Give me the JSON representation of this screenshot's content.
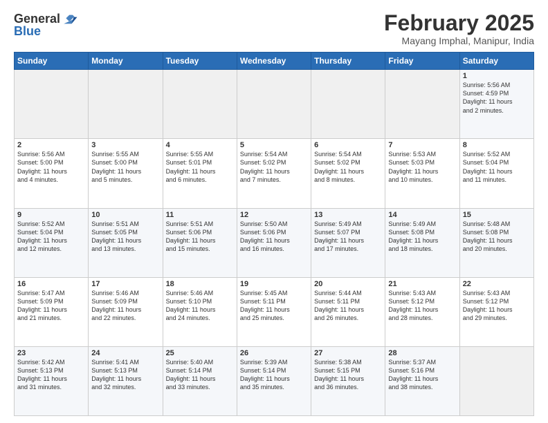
{
  "header": {
    "logo_general": "General",
    "logo_blue": "Blue",
    "month_title": "February 2025",
    "location": "Mayang Imphal, Manipur, India"
  },
  "days_of_week": [
    "Sunday",
    "Monday",
    "Tuesday",
    "Wednesday",
    "Thursday",
    "Friday",
    "Saturday"
  ],
  "weeks": [
    [
      {
        "day": "",
        "info": ""
      },
      {
        "day": "",
        "info": ""
      },
      {
        "day": "",
        "info": ""
      },
      {
        "day": "",
        "info": ""
      },
      {
        "day": "",
        "info": ""
      },
      {
        "day": "",
        "info": ""
      },
      {
        "day": "1",
        "info": "Sunrise: 5:56 AM\nSunset: 4:59 PM\nDaylight: 11 hours\nand 2 minutes."
      }
    ],
    [
      {
        "day": "2",
        "info": "Sunrise: 5:56 AM\nSunset: 5:00 PM\nDaylight: 11 hours\nand 4 minutes."
      },
      {
        "day": "3",
        "info": "Sunrise: 5:55 AM\nSunset: 5:00 PM\nDaylight: 11 hours\nand 5 minutes."
      },
      {
        "day": "4",
        "info": "Sunrise: 5:55 AM\nSunset: 5:01 PM\nDaylight: 11 hours\nand 6 minutes."
      },
      {
        "day": "5",
        "info": "Sunrise: 5:54 AM\nSunset: 5:02 PM\nDaylight: 11 hours\nand 7 minutes."
      },
      {
        "day": "6",
        "info": "Sunrise: 5:54 AM\nSunset: 5:02 PM\nDaylight: 11 hours\nand 8 minutes."
      },
      {
        "day": "7",
        "info": "Sunrise: 5:53 AM\nSunset: 5:03 PM\nDaylight: 11 hours\nand 10 minutes."
      },
      {
        "day": "8",
        "info": "Sunrise: 5:52 AM\nSunset: 5:04 PM\nDaylight: 11 hours\nand 11 minutes."
      }
    ],
    [
      {
        "day": "9",
        "info": "Sunrise: 5:52 AM\nSunset: 5:04 PM\nDaylight: 11 hours\nand 12 minutes."
      },
      {
        "day": "10",
        "info": "Sunrise: 5:51 AM\nSunset: 5:05 PM\nDaylight: 11 hours\nand 13 minutes."
      },
      {
        "day": "11",
        "info": "Sunrise: 5:51 AM\nSunset: 5:06 PM\nDaylight: 11 hours\nand 15 minutes."
      },
      {
        "day": "12",
        "info": "Sunrise: 5:50 AM\nSunset: 5:06 PM\nDaylight: 11 hours\nand 16 minutes."
      },
      {
        "day": "13",
        "info": "Sunrise: 5:49 AM\nSunset: 5:07 PM\nDaylight: 11 hours\nand 17 minutes."
      },
      {
        "day": "14",
        "info": "Sunrise: 5:49 AM\nSunset: 5:08 PM\nDaylight: 11 hours\nand 18 minutes."
      },
      {
        "day": "15",
        "info": "Sunrise: 5:48 AM\nSunset: 5:08 PM\nDaylight: 11 hours\nand 20 minutes."
      }
    ],
    [
      {
        "day": "16",
        "info": "Sunrise: 5:47 AM\nSunset: 5:09 PM\nDaylight: 11 hours\nand 21 minutes."
      },
      {
        "day": "17",
        "info": "Sunrise: 5:46 AM\nSunset: 5:09 PM\nDaylight: 11 hours\nand 22 minutes."
      },
      {
        "day": "18",
        "info": "Sunrise: 5:46 AM\nSunset: 5:10 PM\nDaylight: 11 hours\nand 24 minutes."
      },
      {
        "day": "19",
        "info": "Sunrise: 5:45 AM\nSunset: 5:11 PM\nDaylight: 11 hours\nand 25 minutes."
      },
      {
        "day": "20",
        "info": "Sunrise: 5:44 AM\nSunset: 5:11 PM\nDaylight: 11 hours\nand 26 minutes."
      },
      {
        "day": "21",
        "info": "Sunrise: 5:43 AM\nSunset: 5:12 PM\nDaylight: 11 hours\nand 28 minutes."
      },
      {
        "day": "22",
        "info": "Sunrise: 5:43 AM\nSunset: 5:12 PM\nDaylight: 11 hours\nand 29 minutes."
      }
    ],
    [
      {
        "day": "23",
        "info": "Sunrise: 5:42 AM\nSunset: 5:13 PM\nDaylight: 11 hours\nand 31 minutes."
      },
      {
        "day": "24",
        "info": "Sunrise: 5:41 AM\nSunset: 5:13 PM\nDaylight: 11 hours\nand 32 minutes."
      },
      {
        "day": "25",
        "info": "Sunrise: 5:40 AM\nSunset: 5:14 PM\nDaylight: 11 hours\nand 33 minutes."
      },
      {
        "day": "26",
        "info": "Sunrise: 5:39 AM\nSunset: 5:14 PM\nDaylight: 11 hours\nand 35 minutes."
      },
      {
        "day": "27",
        "info": "Sunrise: 5:38 AM\nSunset: 5:15 PM\nDaylight: 11 hours\nand 36 minutes."
      },
      {
        "day": "28",
        "info": "Sunrise: 5:37 AM\nSunset: 5:16 PM\nDaylight: 11 hours\nand 38 minutes."
      },
      {
        "day": "",
        "info": ""
      }
    ]
  ],
  "colors": {
    "header_bg": "#2a6db5",
    "odd_row": "#f5f7fa",
    "even_row": "#ffffff",
    "empty_cell": "#efefef"
  }
}
